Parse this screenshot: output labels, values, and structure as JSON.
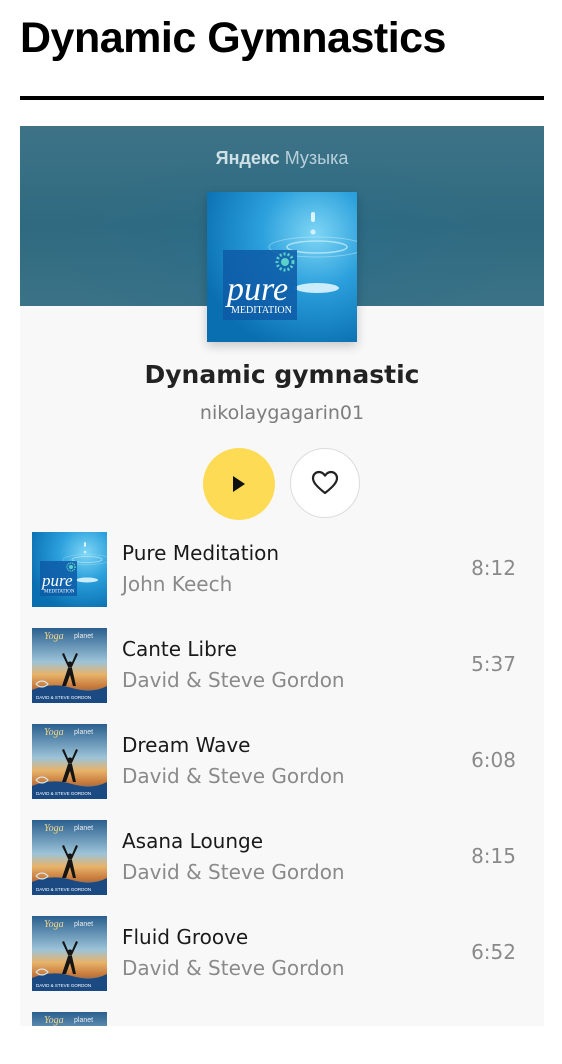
{
  "page": {
    "title": "Dynamic Gymnastics"
  },
  "widget": {
    "brand_bold": "Яндекс",
    "brand_light": "Музыка",
    "cover_text": "pure",
    "cover_subtext": "MEDITATION",
    "playlist_title": "Dynamic gymnastic",
    "owner": "nikolaygagarin01",
    "play_icon": "play-icon",
    "like_icon": "heart-icon"
  },
  "colors": {
    "play_button": "#fedb55",
    "banner": "#3a7186",
    "background": "#f8f8f8"
  },
  "album_art": {
    "pure_label": "pure",
    "pure_sub": "MEDITATION",
    "yoga_word": "Yoga",
    "yoga_planet": "planet",
    "yoga_credit": "DAVID & STEVE GORDON"
  },
  "tracks": [
    {
      "title": "Pure Meditation",
      "artist": "John Keech",
      "duration": "8:12",
      "cover": "pure-meditation"
    },
    {
      "title": "Cante Libre",
      "artist": "David & Steve Gordon",
      "duration": "5:37",
      "cover": "yoga-planet"
    },
    {
      "title": "Dream Wave",
      "artist": "David & Steve Gordon",
      "duration": "6:08",
      "cover": "yoga-planet"
    },
    {
      "title": "Asana Lounge",
      "artist": "David & Steve Gordon",
      "duration": "8:15",
      "cover": "yoga-planet"
    },
    {
      "title": "Fluid Groove",
      "artist": "David & Steve Gordon",
      "duration": "6:52",
      "cover": "yoga-planet"
    },
    {
      "title": "",
      "artist": "",
      "duration": "",
      "cover": "yoga-planet"
    }
  ]
}
